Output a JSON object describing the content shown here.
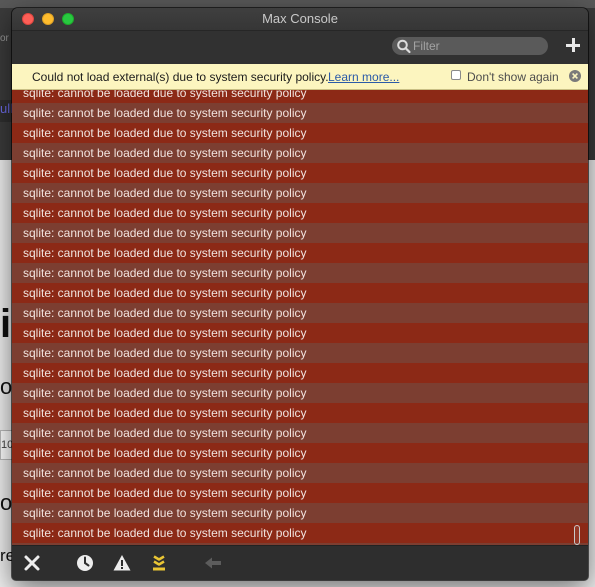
{
  "window": {
    "title": "Max Console"
  },
  "toolbar": {
    "filter_placeholder": "Filter",
    "filter_icon": "search-icon",
    "add_icon": "plus-icon"
  },
  "notice": {
    "message": "Could not load external(s) due to system security policy.",
    "link": "Learn more...",
    "checkbox_label": "Don't show again",
    "checkbox_checked": false,
    "close_icon": "close-circle-icon"
  },
  "log": {
    "rows": [
      "sqlite: cannot be loaded due to system security policy",
      "sqlite: cannot be loaded due to system security policy",
      "sqlite: cannot be loaded due to system security policy",
      "sqlite: cannot be loaded due to system security policy",
      "sqlite: cannot be loaded due to system security policy",
      "sqlite: cannot be loaded due to system security policy",
      "sqlite: cannot be loaded due to system security policy",
      "sqlite: cannot be loaded due to system security policy",
      "sqlite: cannot be loaded due to system security policy",
      "sqlite: cannot be loaded due to system security policy",
      "sqlite: cannot be loaded due to system security policy",
      "sqlite: cannot be loaded due to system security policy",
      "sqlite: cannot be loaded due to system security policy",
      "sqlite: cannot be loaded due to system security policy",
      "sqlite: cannot be loaded due to system security policy",
      "sqlite: cannot be loaded due to system security policy",
      "sqlite: cannot be loaded due to system security policy",
      "sqlite: cannot be loaded due to system security policy",
      "sqlite: cannot be loaded due to system security policy",
      "sqlite: cannot be loaded due to system security policy",
      "sqlite: cannot be loaded due to system security policy",
      "sqlite: cannot be loaded due to system security policy",
      "sqlite: cannot be loaded due to system security policy",
      "sqlite: cannot be loaded due to system security policy"
    ]
  },
  "bottom_bar": {
    "icons": [
      "clear-x-icon",
      "clock-icon",
      "warning-icon",
      "scroll-to-bottom-icon",
      "back-arrow-icon"
    ]
  },
  "background": {
    "fragments": [
      "or",
      "ull",
      "i",
      "o",
      "10",
      "o",
      "re"
    ]
  },
  "colors": {
    "error_row": "#8c2916",
    "error_row_alt": "#7c3e31",
    "notice_bg": "#fcf5bf",
    "accent_yellow": "#e9c534"
  }
}
